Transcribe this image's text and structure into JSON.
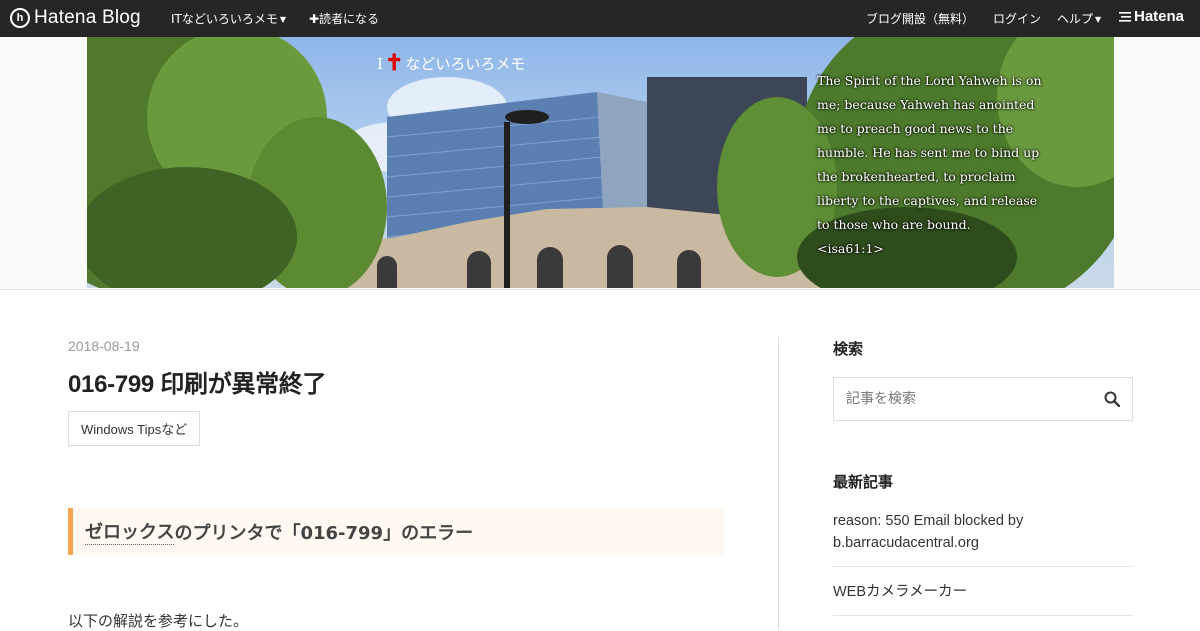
{
  "topbar": {
    "logo_mark": "h",
    "logo_text": "Hatena Blog",
    "blog_menu": "ITなどいろいろメモ",
    "subscribe": "✚読者になる",
    "open_blog": "ブログ開設（無料）",
    "login": "ログイン",
    "help": "ヘルプ",
    "hatena": "Hatena"
  },
  "header": {
    "title_prefix": "I",
    "title_suffix": "などいろいろメモ",
    "quote": "The Spirit of the Lord Yahweh is on me; because Yahweh has anointed me to preach good news to the humble. He has sent me to bind up the brokenhearted, to proclaim liberty to the captives, and release to those who are bound.　<isa61:1>"
  },
  "entry": {
    "date": "2018-08-19",
    "title": "016-799 印刷が異常終了",
    "category": "Windows Tipsなど",
    "h3_link": "ゼロックス",
    "h3_rest": "のプリンタで「016-799」のエラー",
    "paragraph": "以下の解説を参考にした。"
  },
  "sidebar": {
    "search_title": "検索",
    "search_placeholder": "記事を検索",
    "recent_title": "最新記事",
    "recent": [
      "reason: 550 Email blocked by b.barracudacentral.org",
      "WEBカメラメーカー"
    ]
  },
  "colors": {
    "topbar_bg": "#262626",
    "h3_accent": "#f5a54f",
    "h3_bg": "#fff9f1",
    "cross_red": "#e00000"
  }
}
